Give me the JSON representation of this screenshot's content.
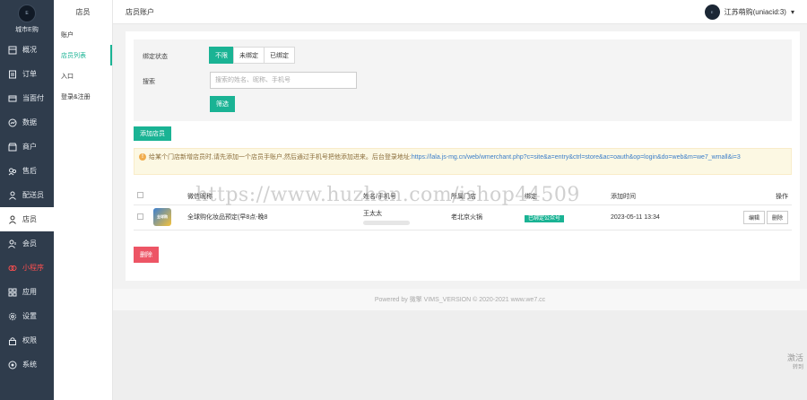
{
  "brand": {
    "name": "城市E购",
    "logo_text": "E"
  },
  "sidebar": {
    "items": [
      {
        "label": "概况",
        "icon": "overview-icon"
      },
      {
        "label": "订单",
        "icon": "order-icon"
      },
      {
        "label": "当面付",
        "icon": "pay-icon"
      },
      {
        "label": "数据",
        "icon": "data-icon"
      },
      {
        "label": "商户",
        "icon": "merchant-icon"
      },
      {
        "label": "售后",
        "icon": "aftersale-icon"
      },
      {
        "label": "配送员",
        "icon": "courier-icon"
      },
      {
        "label": "店员",
        "icon": "staff-icon",
        "active": true
      },
      {
        "label": "会员",
        "icon": "member-icon"
      },
      {
        "label": "小程序",
        "icon": "miniprogram-icon",
        "red": true
      },
      {
        "label": "应用",
        "icon": "apps-icon"
      },
      {
        "label": "设置",
        "icon": "settings-icon"
      },
      {
        "label": "权限",
        "icon": "permission-icon"
      },
      {
        "label": "系统",
        "icon": "system-icon"
      }
    ]
  },
  "subnav": {
    "title": "店员",
    "items": [
      {
        "label": "账户"
      },
      {
        "label": "店员列表",
        "selected": true
      },
      {
        "label": "入口"
      },
      {
        "label": "登录&注册"
      }
    ]
  },
  "header": {
    "breadcrumb": "店员账户",
    "user": "江苏萌购(uniacid:3)",
    "user_caret": "▾",
    "avatar_text": "E"
  },
  "filter": {
    "status_label": "绑定状态",
    "status_options": [
      "不限",
      "未绑定",
      "已绑定"
    ],
    "status_selected": 0,
    "search_label": "搜索",
    "search_placeholder": "搜索的姓名、昵称、手机号",
    "search_value": "",
    "submit_label": "筛选"
  },
  "actions": {
    "add_label": "添加店员",
    "delete_label": "删除"
  },
  "notice": {
    "text": "给某个门店新增店员时,请先添加一个店员手账户,然后通过手机号把他添加进来。后台登录地址:",
    "link": "https://lala.js-mg.cn/web/wmerchant.php?c=site&a=entry&ctrl=store&ac=oauth&op=login&do=web&m=we7_wmall&i=3"
  },
  "table": {
    "columns": [
      "",
      "",
      "微信昵称",
      "姓名/手机号",
      "所属门店",
      "绑定",
      "添加时间",
      "操作"
    ],
    "rows": [
      {
        "thumb_text": "全球购",
        "nickname": "全球购化妆品预定(早8点-晚8",
        "name": "王太太",
        "store": "老北京火锅",
        "bind": "已绑定公众号",
        "time": "2023-05-11 13:34",
        "edit_label": "编辑",
        "delete_label": "删除"
      }
    ]
  },
  "footer": "Powered by 微擎 VIMS_VERSION © 2020-2021 www.we7.cc",
  "watermark": "https://www.huzhan.com/ishop44509",
  "os_watermark": {
    "line1": "激活",
    "line2": "转到"
  },
  "colors": {
    "accent": "#1ab394",
    "danger": "#ed5565",
    "sidebar_bg": "#2f3c4c",
    "notice_bg": "#fcf8e3"
  }
}
